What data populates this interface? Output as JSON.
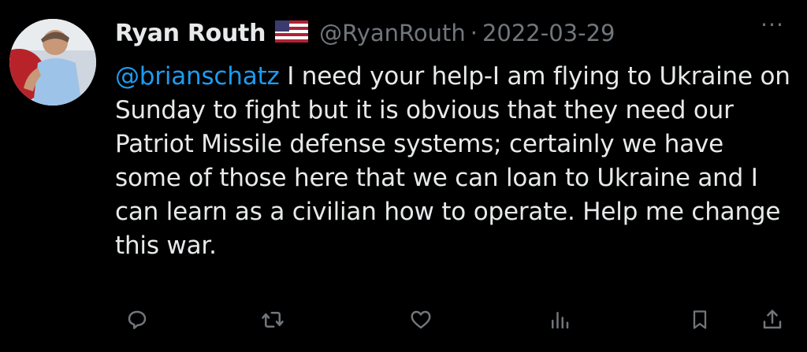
{
  "tweet": {
    "display_name": "Ryan Routh",
    "handle": "@RyanRouth",
    "separator": "·",
    "date": "2022-03-29",
    "more_label": "···",
    "mention": "@brianschatz",
    "text_after_mention": " I need your help-I am flying to Ukraine on Sunday to fight but it is obvious that they need our Patriot Missile defense systems; certainly we have some of those here that we can loan to Ukraine and I can learn as a civilian how to operate.  Help me change this war."
  },
  "icons": {
    "flag": "us-flag-icon",
    "reply": "reply-icon",
    "retweet": "retweet-icon",
    "like": "heart-icon",
    "views": "views-icon",
    "bookmark": "bookmark-icon",
    "share": "share-icon"
  },
  "colors": {
    "background": "#000000",
    "text": "#e7e9ea",
    "secondary": "#71767b",
    "link": "#1d9bf0"
  }
}
